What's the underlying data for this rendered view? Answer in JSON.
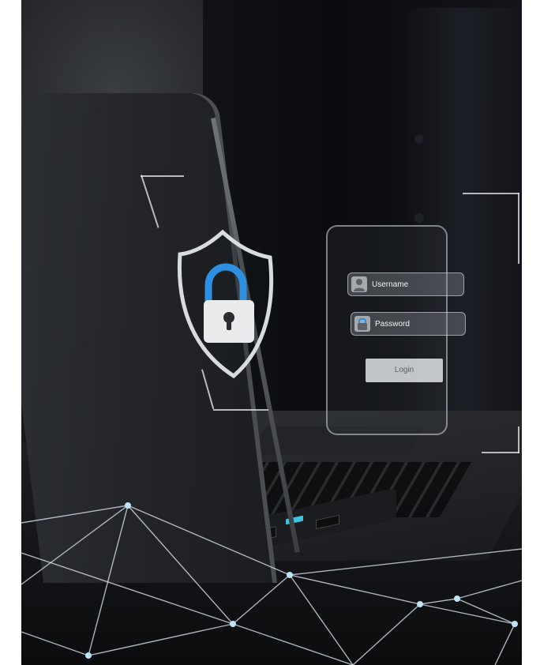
{
  "login_form": {
    "username_label": "Username",
    "password_label": "Password",
    "login_label": "Login"
  },
  "icons": {
    "shield": "shield-lock-icon",
    "user": "user-icon",
    "lock": "lock-icon"
  },
  "colors": {
    "lock_shackle": "#2e8fe0",
    "usb_port": "#3ec3e0",
    "overlay_line": "#e6e9ed"
  }
}
